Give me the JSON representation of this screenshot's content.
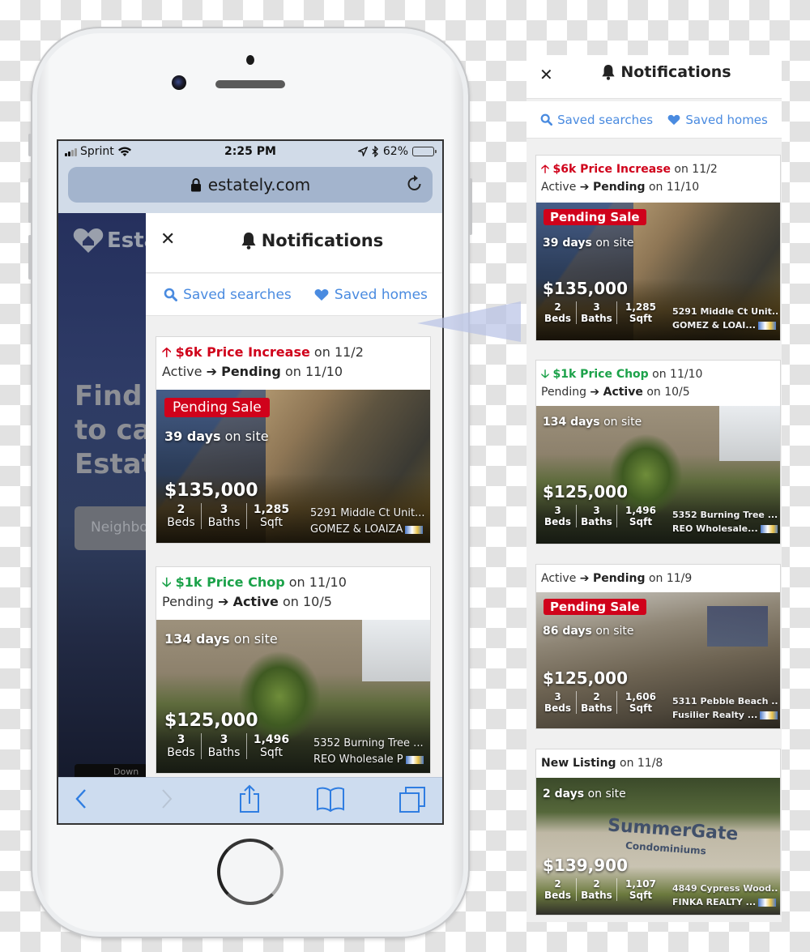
{
  "status_bar": {
    "carrier": "Sprint",
    "time": "2:25 PM",
    "battery_percent_label": "62%",
    "battery_level": 0.62
  },
  "browser": {
    "url": "estately.com",
    "lock_icon": "lock-icon",
    "reload_icon": "reload-icon"
  },
  "background_page": {
    "logo_text": "Esta",
    "heading": "Find\nto ca\nEstat",
    "search_placeholder": "Neighbo",
    "app_badge": "Down"
  },
  "notifications": {
    "title": "Notifications",
    "close_icon": "close-icon",
    "bell_icon": "bell-icon",
    "tabs": [
      {
        "label": "Saved searches",
        "icon": "search-icon"
      },
      {
        "label": "Saved homes",
        "icon": "heart-icon"
      }
    ]
  },
  "cards": [
    {
      "event": {
        "direction": "up",
        "label": "$6k Price Increase",
        "type": "increase",
        "date": "on 11/2"
      },
      "status_change": {
        "from": "Active",
        "to": "Pending",
        "date": "on 11/10"
      },
      "badge": "Pending Sale",
      "days_value": "39 days",
      "days_suffix": "on site",
      "price": "$135,000",
      "beds": "2",
      "beds_label": "Beds",
      "baths": "3",
      "baths_label": "Baths",
      "sqft": "1,285",
      "sqft_label": "Sqft",
      "address": "5291 Middle Ct Unit...",
      "broker": "GOMEZ & LOAIZA",
      "broker_short": "GOMEZ & LOAI..."
    },
    {
      "event": {
        "direction": "down",
        "label": "$1k Price Chop",
        "type": "chop",
        "date": "on 11/10"
      },
      "status_change": {
        "from": "Pending",
        "to": "Active",
        "date": "on 10/5"
      },
      "badge": "",
      "days_value": "134 days",
      "days_suffix": "on site",
      "price": "$125,000",
      "beds": "3",
      "beds_label": "Beds",
      "baths": "3",
      "baths_label": "Baths",
      "sqft": "1,496",
      "sqft_label": "Sqft",
      "address": "5352 Burning Tree ...",
      "broker": "REO Wholesale P",
      "broker_short": "REO Wholesale..."
    },
    {
      "event": null,
      "status_change": {
        "from": "Active",
        "to": "Pending",
        "date": "on 11/9"
      },
      "badge": "Pending Sale",
      "days_value": "86 days",
      "days_suffix": "on site",
      "price": "$125,000",
      "beds": "3",
      "beds_label": "Beds",
      "baths": "2",
      "baths_label": "Baths",
      "sqft": "1,606",
      "sqft_label": "Sqft",
      "address": "5311 Pebble Beach ...",
      "broker_short": "Fusilier Realty ..."
    },
    {
      "event": null,
      "new_listing": {
        "label": "New Listing",
        "date": "on 11/8"
      },
      "badge": "",
      "days_value": "2 days",
      "days_suffix": "on site",
      "price": "$139,900",
      "beds": "2",
      "beds_label": "Beds",
      "baths": "2",
      "baths_label": "Baths",
      "sqft": "1,107",
      "sqft_label": "Sqft",
      "address": "4849 Cypress Wood...",
      "broker_short": "FINKA REALTY ...",
      "sign_text_1": "SummerGate",
      "sign_text_2": "Condominiums"
    }
  ],
  "toolbar": {
    "back_icon": "back-icon",
    "forward_icon": "forward-icon",
    "share_icon": "share-icon",
    "bookmarks_icon": "bookmarks-icon",
    "tabs_icon": "tabs-icon"
  },
  "colors": {
    "accent_blue": "#4a8be0",
    "price_increase_red": "#d0021b",
    "price_chop_green": "#1ca24a",
    "badge_red": "#d0021b",
    "toolbar_blue": "#2f7de1"
  }
}
